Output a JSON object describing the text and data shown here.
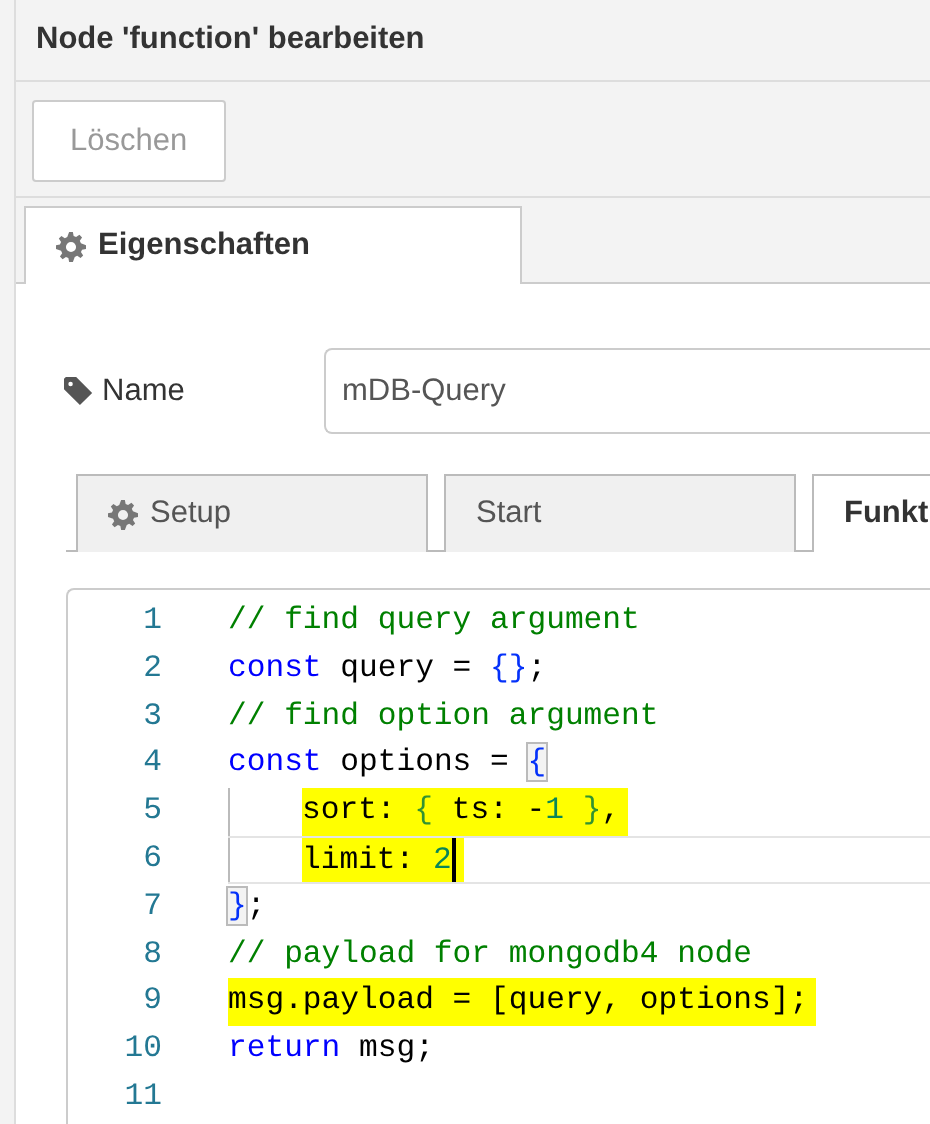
{
  "window": {
    "title": "Node 'function' bearbeiten"
  },
  "toolbar": {
    "buttons": [
      {
        "label": "Löschen",
        "disabled": true
      }
    ]
  },
  "tabs": [
    {
      "label": "Eigenschaften",
      "has_icon": true,
      "selected": true
    }
  ],
  "name_field": {
    "label": "Name",
    "value": "mDB-Query"
  },
  "sub_tabs": [
    {
      "label": "Setup",
      "has_icon": true,
      "selected": false
    },
    {
      "label": "Start",
      "has_icon": false,
      "selected": false
    },
    {
      "label": "Funkt",
      "has_icon": false,
      "selected": true
    }
  ],
  "editor": {
    "lines": [
      {
        "number": "1",
        "indented": false,
        "highlighted": false,
        "current": false,
        "tokens": [
          {
            "text": "// find query argument",
            "kind": "comment"
          }
        ]
      },
      {
        "number": "2",
        "indented": false,
        "highlighted": false,
        "current": false,
        "tokens": [
          {
            "text": "const",
            "kind": "keyword"
          },
          {
            "text": " query = ",
            "kind": "plain"
          },
          {
            "text": "{}",
            "kind": "bracket"
          },
          {
            "text": ";",
            "kind": "plain"
          }
        ]
      },
      {
        "number": "3",
        "indented": false,
        "highlighted": false,
        "current": false,
        "tokens": [
          {
            "text": "// find option argument",
            "kind": "comment"
          }
        ]
      },
      {
        "number": "4",
        "indented": false,
        "highlighted": false,
        "current": false,
        "tokens": [
          {
            "text": "const",
            "kind": "keyword"
          },
          {
            "text": " options = ",
            "kind": "plain"
          },
          {
            "text": "{",
            "kind": "matched"
          }
        ]
      },
      {
        "number": "5",
        "indented": true,
        "highlighted": true,
        "current": false,
        "tokens": [
          {
            "text": "sort: ",
            "kind": "plain"
          },
          {
            "text": "{",
            "kind": "inner"
          },
          {
            "text": " ts: -",
            "kind": "plain"
          },
          {
            "text": "1",
            "kind": "number"
          },
          {
            "text": " }",
            "kind": "inner"
          },
          {
            "text": ",",
            "kind": "plain"
          }
        ]
      },
      {
        "number": "6",
        "indented": true,
        "highlighted": true,
        "current": true,
        "tokens": [
          {
            "text": "limit: ",
            "kind": "plain"
          },
          {
            "text": "2",
            "kind": "number"
          }
        ]
      },
      {
        "number": "7",
        "indented": false,
        "highlighted": false,
        "current": false,
        "tokens": [
          {
            "text": "}",
            "kind": "matched"
          },
          {
            "text": ";",
            "kind": "plain"
          }
        ]
      },
      {
        "number": "8",
        "indented": false,
        "highlighted": false,
        "current": false,
        "tokens": [
          {
            "text": "// payload for mongodb4 node",
            "kind": "comment"
          }
        ]
      },
      {
        "number": "9",
        "indented": false,
        "highlighted": true,
        "current": false,
        "tokens": [
          {
            "text": "msg.payload = [query, options];",
            "kind": "plain"
          }
        ]
      },
      {
        "number": "10",
        "indented": false,
        "highlighted": false,
        "current": false,
        "tokens": [
          {
            "text": "return",
            "kind": "keyword"
          },
          {
            "text": " msg;",
            "kind": "plain"
          }
        ]
      },
      {
        "number": "11",
        "indented": false,
        "highlighted": false,
        "current": false
      }
    ]
  }
}
